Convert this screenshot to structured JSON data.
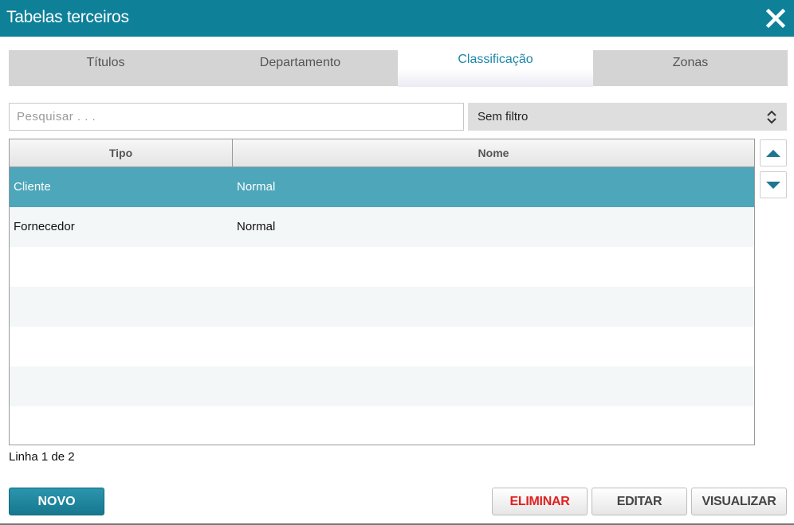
{
  "window": {
    "title": "Tabelas terceiros",
    "close_icon": "close-icon"
  },
  "tabs": [
    {
      "label": "Títulos",
      "active": false
    },
    {
      "label": "Departamento",
      "active": false
    },
    {
      "label": "Classificação",
      "active": true
    },
    {
      "label": "Zonas",
      "active": false
    }
  ],
  "search": {
    "placeholder": "Pesquisar . . .",
    "value": ""
  },
  "filter": {
    "selected": "Sem filtro"
  },
  "table": {
    "columns": [
      "Tipo",
      "Nome"
    ],
    "rows": [
      {
        "tipo": "Cliente",
        "nome": "Normal",
        "selected": true
      },
      {
        "tipo": "Fornecedor",
        "nome": "Normal",
        "selected": false
      }
    ]
  },
  "scroll": {
    "up_icon": "triangle-up-icon",
    "down_icon": "triangle-down-icon"
  },
  "status": "Linha 1 de 2",
  "actions": {
    "new": "NOVO",
    "delete": "ELIMINAR",
    "edit": "EDITAR",
    "view": "VISUALIZAR"
  },
  "colors": {
    "titlebar": "#0e8098",
    "selected_row": "#4da6b9",
    "active_tab_text": "#1c86a8",
    "delete_text": "#e02020"
  }
}
